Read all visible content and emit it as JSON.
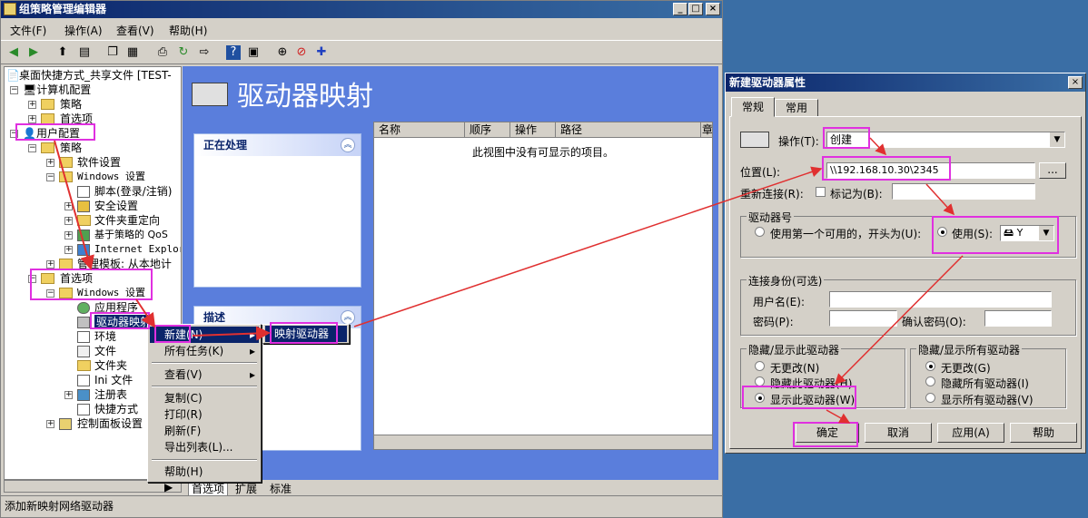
{
  "window": {
    "title": "组策略管理编辑器",
    "min": "_",
    "max": "□",
    "close": "×"
  },
  "menubar": {
    "file": "文件(F)",
    "action": "操作(A)",
    "view": "查看(V)",
    "help": "帮助(H)"
  },
  "tree": {
    "root": "桌面快捷方式_共享文件 [TEST-",
    "computer_config": "计算机配置",
    "cc_policies": "策略",
    "cc_prefs": "首选项",
    "user_config": "用户配置",
    "uc_policies": "策略",
    "software_settings": "软件设置",
    "windows_settings": "Windows 设置",
    "scripts": "脚本(登录/注销)",
    "security_settings": "安全设置",
    "folder_redirection": "文件夹重定向",
    "policy_qos": "基于策略的 QoS",
    "ie": "Internet Explor",
    "admin_templates": "管理模板: 从本地计",
    "uc_prefs": "首选项",
    "pref_windows_settings": "Windows 设置",
    "applications": "应用程序",
    "drive_maps": "驱动器映射",
    "environment": "环境",
    "files": "文件",
    "folders": "文件夹",
    "ini_files": "Ini 文件",
    "registry": "注册表",
    "shortcuts": "快捷方式",
    "control_panel": "控制面板设置"
  },
  "right": {
    "header": "驱动器映射",
    "processing_title": "正在处理",
    "description_title": "描述",
    "columns": [
      "名称",
      "顺序",
      "操作",
      "路径",
      "章"
    ],
    "empty_msg": "此视图中没有可显示的项目。",
    "tabs": [
      "首选项",
      "扩展",
      "标准"
    ]
  },
  "context_menu": {
    "new": "新建(N)",
    "all_tasks": "所有任务(K)",
    "view": "查看(V)",
    "copy": "复制(C)",
    "print": "打印(R)",
    "refresh": "刷新(F)",
    "export": "导出列表(L)...",
    "help": "帮助(H)",
    "submenu_mapped_drive": "映射驱动器"
  },
  "status": "添加新映射网络驱动器",
  "dialog": {
    "title": "新建驱动器属性",
    "tab_general": "常规",
    "tab_common": "常用",
    "action_label": "操作(T):",
    "action_value": "创建",
    "location_label": "位置(L):",
    "location_value": "\\\\192.168.10.30\\2345",
    "browse": "...",
    "reconnect_label": "重新连接(R):",
    "label_as": "标记为(B):",
    "drive_letter_group": "驱动器号",
    "use_first": "使用第一个可用的，开头为(U):",
    "use": "使用(S):",
    "drive_letter": "Y",
    "connect_as_group": "连接身份(可选)",
    "username": "用户名(E):",
    "password": "密码(P):",
    "confirm_password": "确认密码(O):",
    "hide_show_this": "隐藏/显示此驱动器",
    "no_change": "无更改(N)",
    "hide_this": "隐藏此驱动器(H)",
    "show_this": "显示此驱动器(W)",
    "hide_show_all": "隐藏/显示所有驱动器",
    "no_change_all": "无更改(G)",
    "hide_all": "隐藏所有驱动器(I)",
    "show_all": "显示所有驱动器(V)",
    "ok": "确定",
    "cancel": "取消",
    "apply": "应用(A)",
    "help": "帮助"
  },
  "colors": {
    "title_blue": "#0a246a",
    "highlight": "#e030e0",
    "arrow": "#e03030",
    "right_bg": "#5a7edc"
  }
}
